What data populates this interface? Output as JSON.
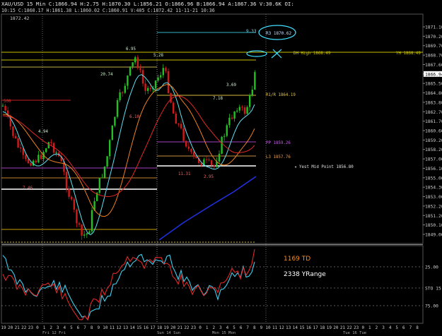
{
  "header": {
    "text": "XAU/USD 15 Min C:1866.94  H:2.75  H:1870.30  L:1856.21  O:1866.96  B:1866.94  A:1867.36  V:30.6K  OI: ",
    "time": "10:15  C:1860.17  H:1861.38  L:1860.02  C:1860.91  V:405  C:1872.42  11-11-21  10:36"
  },
  "top_price": "1872.42",
  "price_axis": {
    "ticks": [
      "1871.10",
      "1870.20",
      "1869.70",
      "1868.70",
      "1867.60",
      "1866.94",
      "1865.50",
      "1864.80",
      "1863.80",
      "1862.70",
      "1861.70",
      "1860.60",
      "1859.20",
      "1858.20",
      "1857.00",
      "1856.10",
      "1855.00",
      "1854.30",
      "1853.00",
      "1852.20",
      "1851.20",
      "1850.10",
      "1849.00"
    ],
    "current": "1866.94"
  },
  "osc_axis": {
    "ticks": [
      "25.00",
      "STO 15.",
      "75.00"
    ]
  },
  "levels": {
    "r3": "R3 1870.62",
    "r3_val": "9.33",
    "d_high": "DH High 1868.49",
    "yh": "YH 1868.49",
    "r1r": "R1/R 1864.19",
    "pp": "PP 1859.26",
    "l3": "L3 1857.76",
    "yest_mid": "Yest Mid Point 1856.80",
    "left_500": "500"
  },
  "annotations": [
    "6.95",
    "5.28",
    "20.74",
    "3.69",
    "7.18",
    "6.10",
    "4.94",
    "11.31",
    "2.95",
    "7.46"
  ],
  "oscillator": {
    "td": "1169 TD",
    "yrange": "2338 YRange"
  },
  "time_axis": {
    "labels": [
      "19",
      "20",
      "21",
      "22",
      "23",
      "0",
      "1",
      "2",
      "3",
      "4",
      "5",
      "6",
      "7",
      "8",
      "9",
      "10",
      "11",
      "12",
      "13",
      "14",
      "15",
      "16",
      "17",
      "18",
      "19",
      "20",
      "21",
      "22",
      "23",
      "0",
      "1",
      "2",
      "3",
      "4",
      "5",
      "6",
      "7",
      "8",
      "9",
      "10",
      "11",
      "12",
      "13",
      "14",
      "15",
      "16",
      "17",
      "18",
      "19",
      "20",
      "21",
      "22",
      "23",
      "0",
      "1",
      "2",
      "3",
      "4",
      "5",
      "6",
      "7",
      "8"
    ],
    "days": [
      "Fri 12 Fri",
      "Sun 14 Sun",
      "Mon 15 Mon",
      "Tue 16 Tue"
    ]
  },
  "colors": {
    "bull": "#22c022",
    "bear": "#d11a1a",
    "ma_cyan": "#5fe0f0",
    "ma_orange": "#f08020",
    "ma_red": "#e02828",
    "ma_blue": "#2030e0",
    "yellow_line": "#c8c000",
    "cyan_line": "#2fb5c5"
  }
}
